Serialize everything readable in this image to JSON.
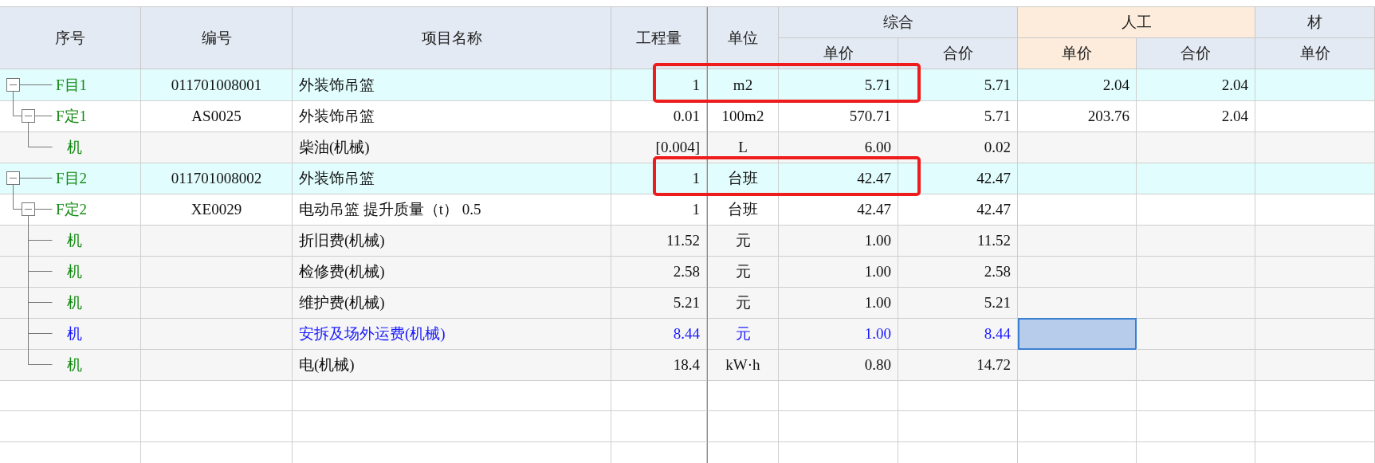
{
  "columns": [
    {
      "label": "序号"
    },
    {
      "label": "编号"
    },
    {
      "label": "项目名称"
    },
    {
      "label": "工程量"
    },
    {
      "label": "单位"
    },
    {
      "label": "综合",
      "selected": false,
      "sub": [
        {
          "label": "单价",
          "selected": false
        },
        {
          "label": "合价",
          "selected": false
        }
      ]
    },
    {
      "label": "人工",
      "selected": true,
      "sub": [
        {
          "label": "单价",
          "selected": true
        },
        {
          "label": "合价",
          "selected": false
        }
      ]
    },
    {
      "label": "材",
      "selected": false,
      "sub": [
        {
          "label": "单价",
          "selected": false
        }
      ]
    }
  ],
  "rows": [
    {
      "kind": "list_item",
      "seq": "F目1",
      "code": "011701008001",
      "name": "外装饰吊篮",
      "qty": "1",
      "unit": "m2",
      "total_unit": "5.71",
      "total_sum": "5.71",
      "labor_unit": "2.04",
      "labor_sum": "2.04",
      "emphasized": false,
      "marked": true,
      "labor_unit_selected": false,
      "expanded": true,
      "children": [
        {
          "kind": "quota",
          "seq": "F定1",
          "code": "AS0025",
          "name": "外装饰吊篮",
          "qty": "0.01",
          "unit": "100m2",
          "total_unit": "570.71",
          "total_sum": "5.71",
          "labor_unit": "203.76",
          "labor_sum": "2.04",
          "emphasized": false,
          "marked": false,
          "labor_unit_selected": false,
          "expanded": true,
          "children": [
            {
              "kind": "machine",
              "seq": "机",
              "name": "柴油(机械)",
              "qty": "[0.004]",
              "unit": "L",
              "total_unit": "6.00",
              "total_sum": "0.02",
              "emphasized": false,
              "marked": false,
              "labor_unit_selected": false
            }
          ]
        }
      ]
    },
    {
      "kind": "list_item",
      "seq": "F目2",
      "code": "011701008002",
      "name": "外装饰吊篮",
      "qty": "1",
      "unit": "台班",
      "total_unit": "42.47",
      "total_sum": "42.47",
      "emphasized": false,
      "marked": true,
      "labor_unit_selected": false,
      "expanded": true,
      "children": [
        {
          "kind": "quota",
          "seq": "F定2",
          "code": "XE0029",
          "name": "电动吊篮 提升质量（t） 0.5",
          "qty": "1",
          "unit": "台班",
          "total_unit": "42.47",
          "total_sum": "42.47",
          "emphasized": false,
          "marked": false,
          "labor_unit_selected": false,
          "expanded": true,
          "children": [
            {
              "kind": "machine",
              "seq": "机",
              "name": "折旧费(机械)",
              "qty": "11.52",
              "unit": "元",
              "total_unit": "1.00",
              "total_sum": "11.52",
              "emphasized": false,
              "marked": false,
              "labor_unit_selected": false
            },
            {
              "kind": "machine",
              "seq": "机",
              "name": "检修费(机械)",
              "qty": "2.58",
              "unit": "元",
              "total_unit": "1.00",
              "total_sum": "2.58",
              "emphasized": false,
              "marked": false,
              "labor_unit_selected": false
            },
            {
              "kind": "machine",
              "seq": "机",
              "name": "维护费(机械)",
              "qty": "5.21",
              "unit": "元",
              "total_unit": "1.00",
              "total_sum": "5.21",
              "emphasized": false,
              "marked": false,
              "labor_unit_selected": false
            },
            {
              "kind": "machine",
              "seq": "机",
              "name": "安拆及场外运费(机械)",
              "qty": "8.44",
              "unit": "元",
              "total_unit": "1.00",
              "total_sum": "8.44",
              "emphasized": true,
              "marked": false,
              "labor_unit_selected": true
            },
            {
              "kind": "machine",
              "seq": "机",
              "name": "电(机械)",
              "qty": "18.4",
              "unit": "kW·h",
              "total_unit": "0.80",
              "total_sum": "14.72",
              "emphasized": false,
              "marked": false,
              "labor_unit_selected": false
            }
          ]
        }
      ]
    }
  ]
}
